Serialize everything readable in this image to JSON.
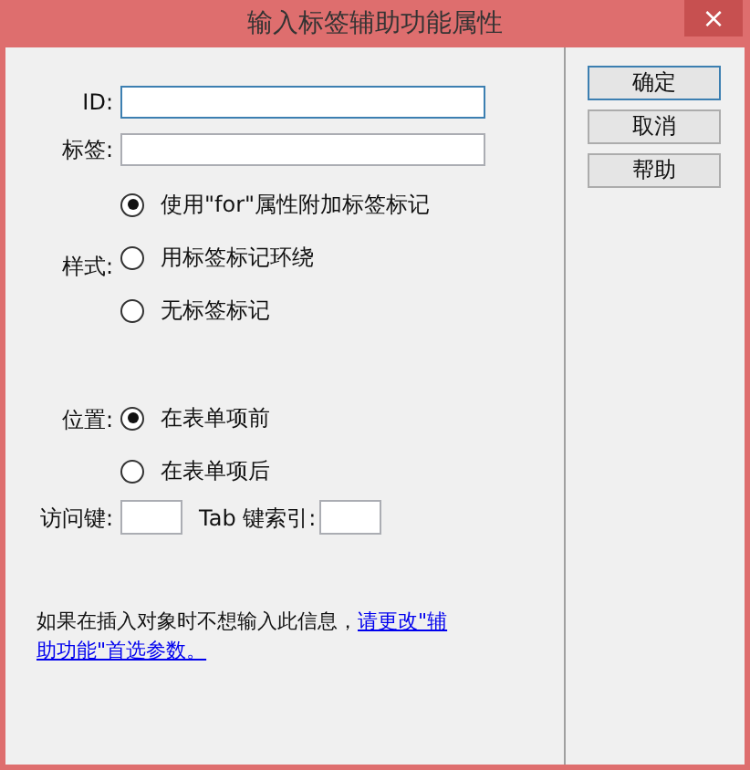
{
  "window": {
    "title": "输入标签辅助功能属性",
    "close": "×"
  },
  "fields": [
    {
      "label": "ID:",
      "focused": true
    },
    {
      "label": "标签:",
      "focused": false
    }
  ],
  "style": {
    "label": "样式:",
    "options": [
      {
        "label": "使用\"for\"属性附加标签标记",
        "selected": true
      },
      {
        "label": "用标签标记环绕",
        "selected": false
      },
      {
        "label": "无标签标记",
        "selected": false
      }
    ]
  },
  "position": {
    "label": "位置:",
    "options": [
      {
        "label": "在表单项前",
        "selected": true
      },
      {
        "label": "在表单项后",
        "selected": false
      }
    ]
  },
  "access_key": {
    "label": "访问键:"
  },
  "tab_index": {
    "label": "Tab 键索引:"
  },
  "note": {
    "text": "如果在插入对象时不想输入此信息，",
    "link_lines": [
      "请更改\"辅",
      "助功能\"首选参数。"
    ]
  },
  "buttons": [
    {
      "label": "确定",
      "default": true
    },
    {
      "label": "取消",
      "default": false
    },
    {
      "label": "帮助",
      "default": false
    }
  ]
}
